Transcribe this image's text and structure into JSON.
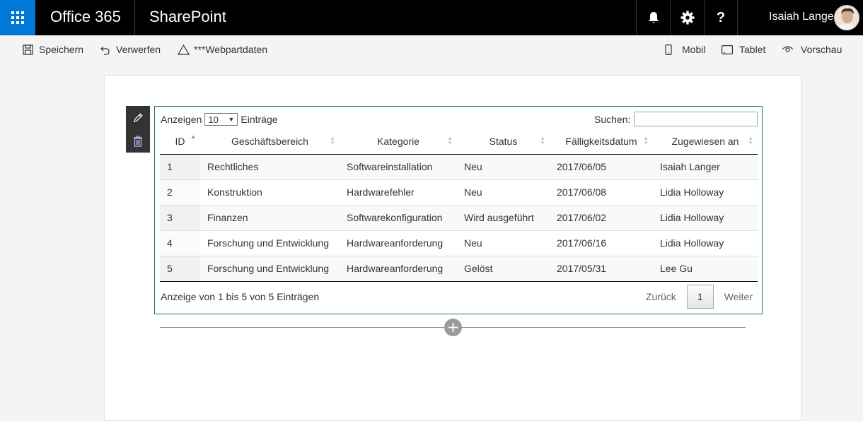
{
  "suitebar": {
    "brand": "Office 365",
    "app": "SharePoint",
    "user_name": "Isaiah Langer",
    "help_label": "?",
    "accent": "#0078d7"
  },
  "commands": {
    "save": "Speichern",
    "discard": "Verwerfen",
    "webpart_data": "***Webpartdaten",
    "mobile": "Mobil",
    "tablet": "Tablet",
    "preview": "Vorschau"
  },
  "table": {
    "length_prefix": "Anzeigen",
    "length_value": "10",
    "length_suffix": "Einträge",
    "search_label": "Suchen:",
    "columns": [
      "ID",
      "Geschäftsbereich",
      "Kategorie",
      "Status",
      "Fälligkeitsdatum",
      "Zugewiesen an"
    ],
    "rows": [
      [
        "1",
        "Rechtliches",
        "Softwareinstallation",
        "Neu",
        "2017/06/05",
        "Isaiah Langer"
      ],
      [
        "2",
        "Konstruktion",
        "Hardwarefehler",
        "Neu",
        "2017/06/08",
        "Lidia Holloway"
      ],
      [
        "3",
        "Finanzen",
        "Softwarekonfiguration",
        "Wird ausgeführt",
        "2017/06/02",
        "Lidia Holloway"
      ],
      [
        "4",
        "Forschung und Entwicklung",
        "Hardwareanforderung",
        "Neu",
        "2017/06/16",
        "Lidia Holloway"
      ],
      [
        "5",
        "Forschung und Entwicklung",
        "Hardwareanforderung",
        "Gelöst",
        "2017/05/31",
        "Lee Gu"
      ]
    ],
    "info": "Anzeige von 1 bis 5 von 5 Einträgen",
    "prev": "Zurück",
    "page": "1",
    "next": "Weiter"
  }
}
